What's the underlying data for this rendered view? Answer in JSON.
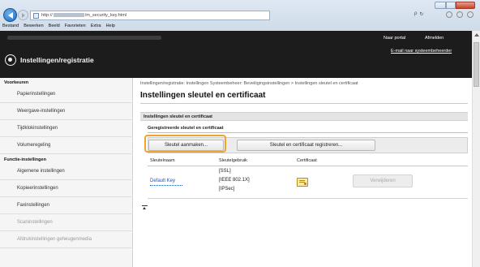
{
  "browser": {
    "url_prefix": "http://",
    "url_suffix": "/m_security_key.html",
    "search_symbol": "ρ",
    "refresh_symbol": "↻",
    "menu": [
      "Bestand",
      "Bewerken",
      "Beeld",
      "Favorieten",
      "Extra",
      "Help"
    ]
  },
  "header": {
    "title": "Instellingen/registratie",
    "portal_link": "Naar portal",
    "logout_link": "Afmelden",
    "email_link": "E-mail naar systeembeheerder"
  },
  "sidebar": {
    "section1": "Voorkeuren",
    "prefs": [
      "Papierinstellingen",
      "Weergave-instellingen",
      "Tijdklokinstellingen",
      "Volumeregeling"
    ],
    "section2": "Functie-instellingen",
    "funcs": [
      "Algemene instellingen",
      "Kopieerinstellingen",
      "Faxinstellingen",
      "Scaninstellingen",
      "Afdrukinstellingen geheugenmedia"
    ]
  },
  "main": {
    "breadcrumb": "Instellingen/registratie: Instellingen Systeembeheer: Beveiligingsinstellingen > Instellingen sleutel en certificaat",
    "title": "Instellingen sleutel en certificaat",
    "section": "Instellingen sleutel en certificaat",
    "subsection": "Geregistreerde sleutel en certificaat",
    "generate_button": "Sleutel aanmaken...",
    "register_button": "Sleutel en certificaat registreren...",
    "columns": [
      "Sleutelnaam",
      "Sleutelgebruik",
      "Certificaat"
    ],
    "rows": [
      {
        "key_name": "Default Key",
        "usage": [
          "[SSL]",
          "[IEEE 802.1X]",
          "[IPSec]"
        ],
        "delete_button": "Verwijderen"
      }
    ]
  },
  "colors": {
    "highlight": "#f0a32d",
    "link": "#1f56b0",
    "header_bg": "#1c1c1c"
  }
}
